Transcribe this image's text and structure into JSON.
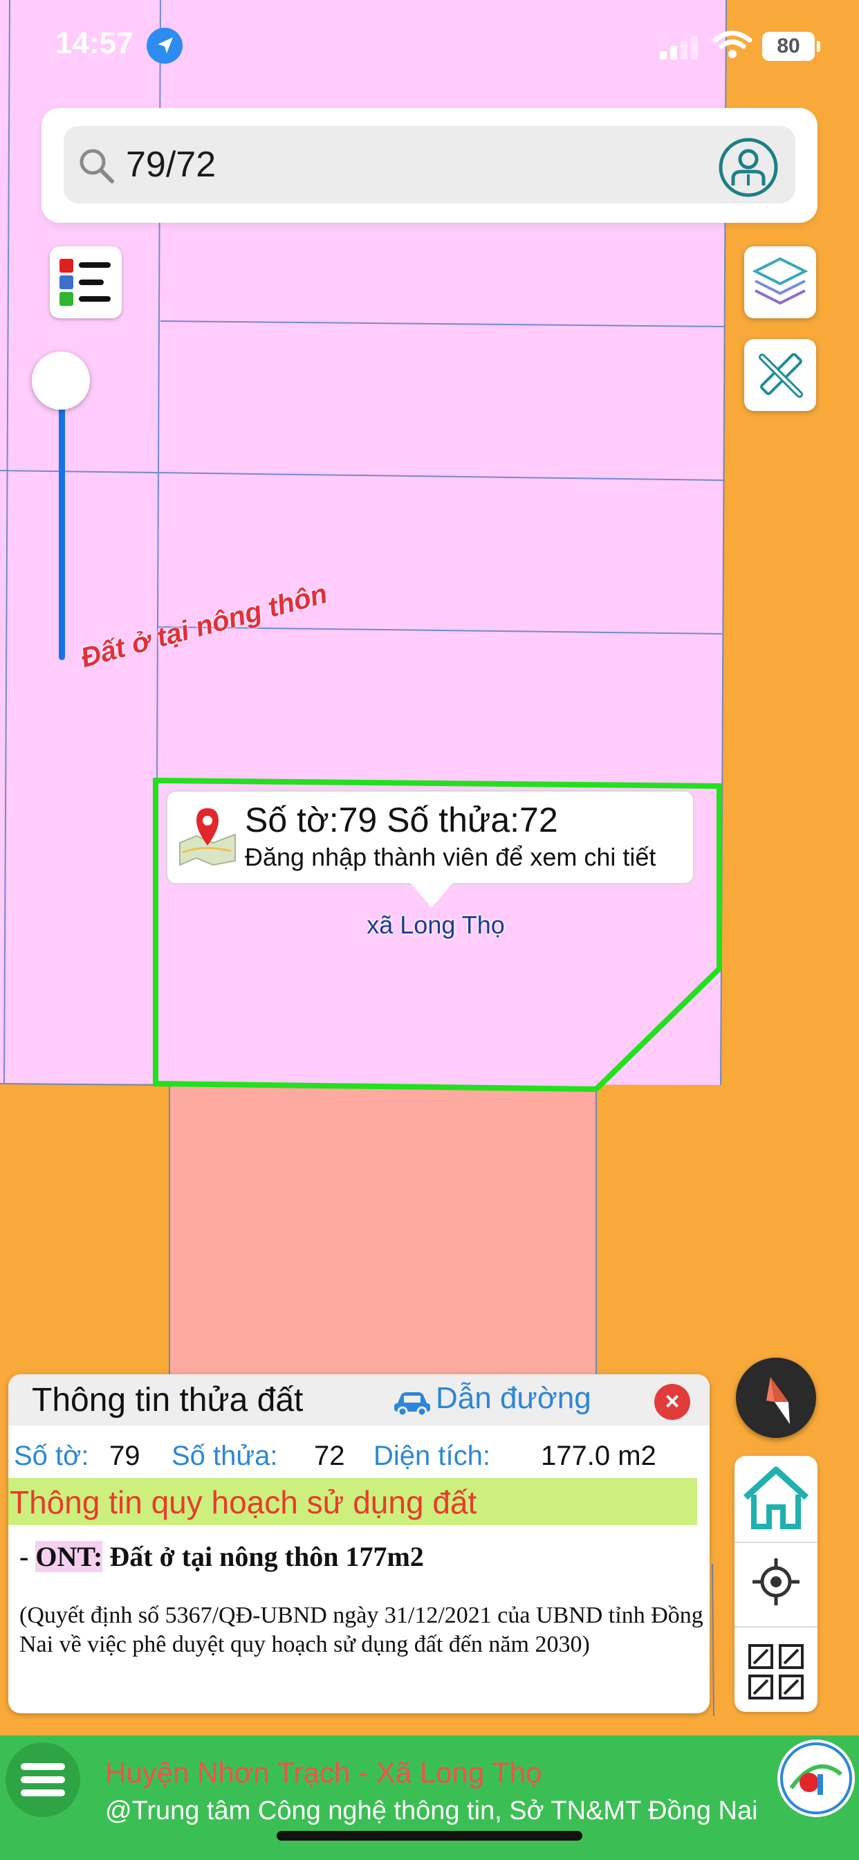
{
  "status_bar": {
    "time": "14:57",
    "battery": "80"
  },
  "search": {
    "value": "79/72"
  },
  "map": {
    "land_use_label": "Đất ở tại nông thôn",
    "commune_label": "xã Long Thọ",
    "colors": {
      "residential": "#ffccfb",
      "road": "#f8a93a",
      "other_land": "#ffaaa0",
      "selected_outline": "#22e01e",
      "parcel_lines": "#5b7fc7"
    }
  },
  "popup": {
    "title": "Số tờ:79 Số thửa:72",
    "subtitle": "Đăng nhập thành viên để xem chi tiết"
  },
  "info_panel": {
    "title": "Thông tin thửa đất",
    "directions_label": "Dẫn đường",
    "close_symbol": "×",
    "sheet_label": "Số tờ:",
    "sheet_value": "79",
    "parcel_label": "Số thửa:",
    "parcel_value": "72",
    "area_label": "Diện tích:",
    "area_value": "177.0 m2",
    "plan_title": "Thông tin quy hoạch sử dụng đất",
    "ont_prefix": "- ",
    "ont_code": "ONT:",
    "ont_text": " Đất ở tại nông thôn 177m2",
    "decision": "(Quyết định số 5367/QĐ-UBND ngày 31/12/2021 của UBND tỉnh Đồng Nai về việc phê duyệt quy hoạch sử dụng đất đến năm 2030)"
  },
  "footer": {
    "line1": "Huyện Nhơn Trạch - Xã Long Thọ",
    "line2": "@Trung tâm Công nghệ thông tin, Sở TN&MT Đồng Nai"
  },
  "icons": {
    "search": "search-icon",
    "user": "user-icon",
    "legend": "legend-icon",
    "layers": "layers-icon",
    "measure": "ruler-pencil-icon",
    "compass": "compass-icon",
    "home": "home-icon",
    "locate": "crosshair-icon",
    "qr": "qr-icon",
    "menu": "menu-icon",
    "car": "car-icon"
  }
}
